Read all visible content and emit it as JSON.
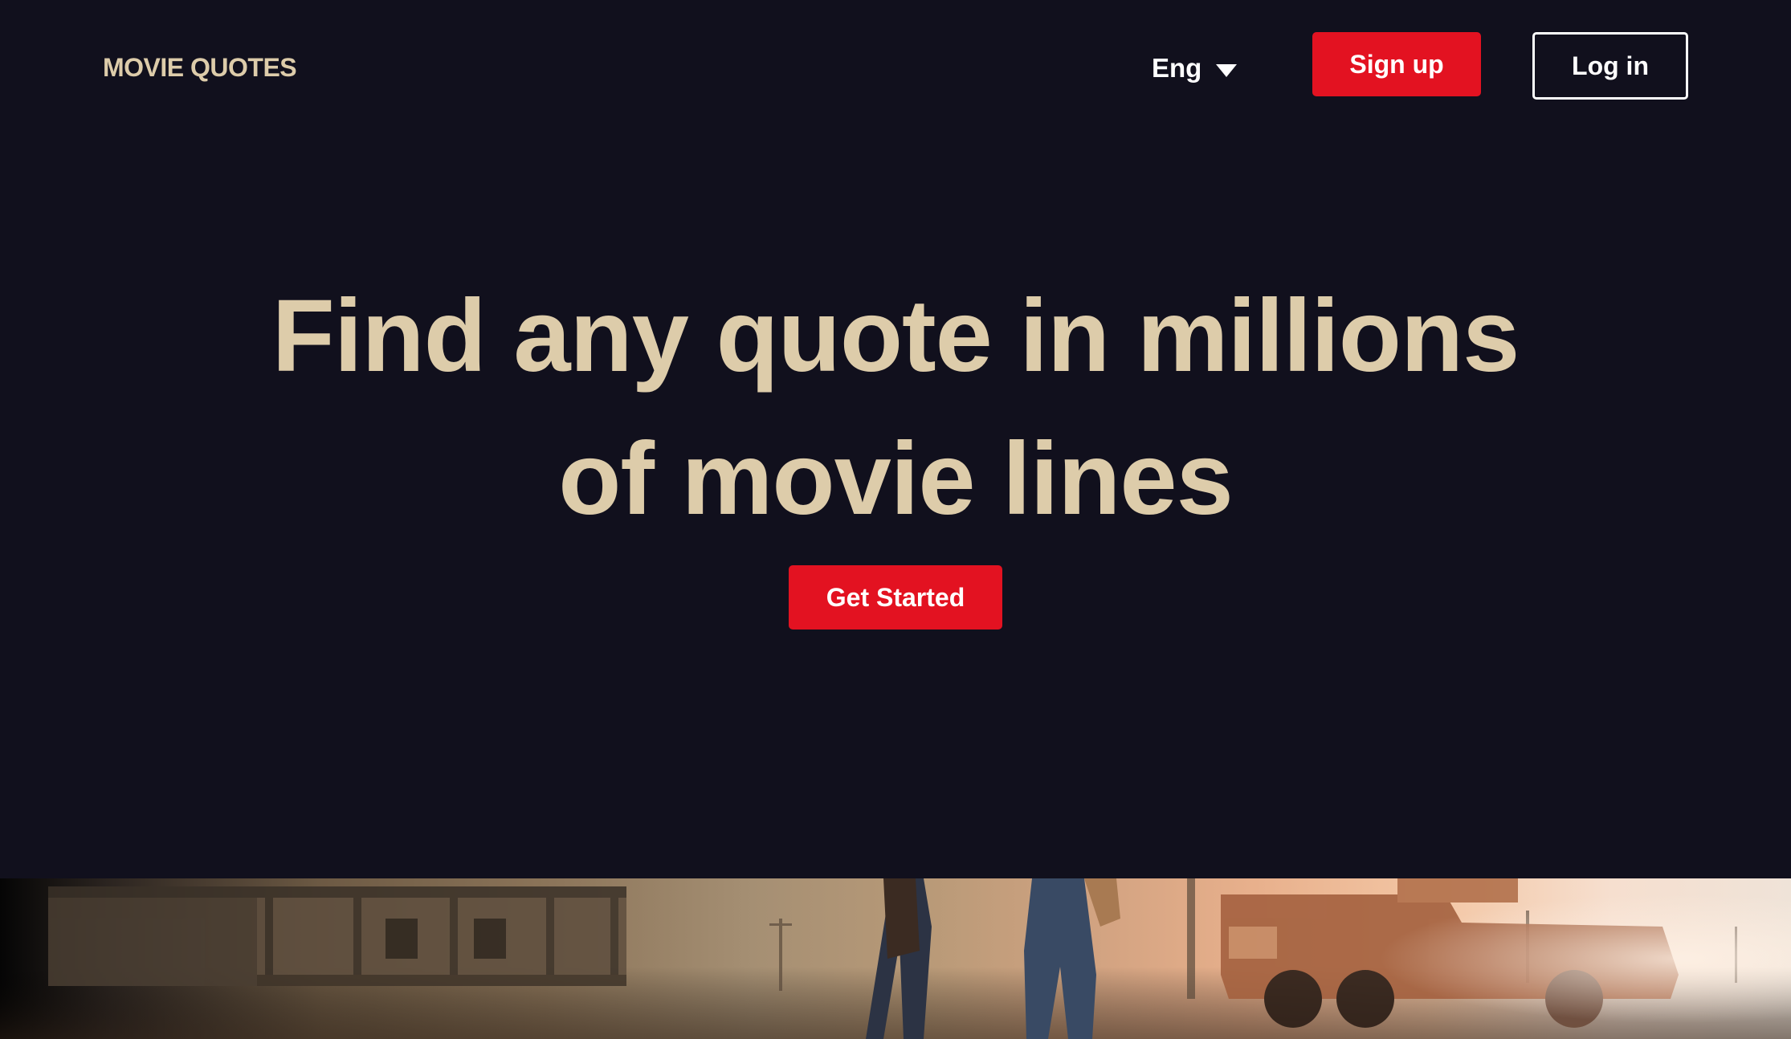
{
  "header": {
    "logo": "MOVIE QUOTES",
    "language": "Eng",
    "signup_label": "Sign up",
    "login_label": "Log in"
  },
  "hero": {
    "title_line1": "Find any quote in millions",
    "title_line2": "of movie lines",
    "cta_label": "Get Started"
  },
  "colors": {
    "background": "#11101d",
    "accent_gold": "#ddccaa",
    "brand_red": "#e31221",
    "text_white": "#ffffff"
  },
  "icons": {
    "language_dropdown": "caret-down-icon"
  }
}
